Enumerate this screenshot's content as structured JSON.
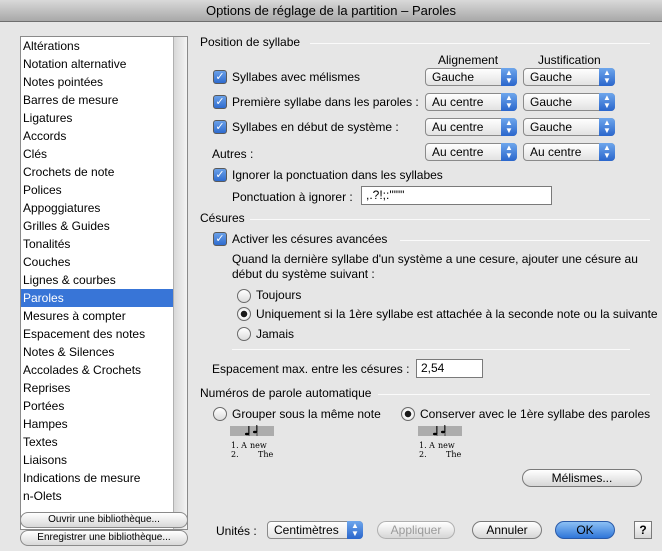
{
  "window": {
    "title": "Options de réglage de la partition – Paroles"
  },
  "sidebar": {
    "items": [
      {
        "label": "Altérations"
      },
      {
        "label": "Notation alternative"
      },
      {
        "label": "Notes pointées"
      },
      {
        "label": "Barres de mesure"
      },
      {
        "label": "Ligatures"
      },
      {
        "label": "Accords"
      },
      {
        "label": "Clés"
      },
      {
        "label": "Crochets de note"
      },
      {
        "label": "Polices"
      },
      {
        "label": "Appoggiatures"
      },
      {
        "label": "Grilles & Guides"
      },
      {
        "label": "Tonalités"
      },
      {
        "label": "Couches"
      },
      {
        "label": "Lignes & courbes"
      },
      {
        "label": "Paroles"
      },
      {
        "label": "Mesures à compter"
      },
      {
        "label": "Espacement des notes"
      },
      {
        "label": "Notes & Silences"
      },
      {
        "label": "Accolades & Crochets"
      },
      {
        "label": "Reprises"
      },
      {
        "label": "Portées"
      },
      {
        "label": "Hampes"
      },
      {
        "label": "Textes"
      },
      {
        "label": "Liaisons"
      },
      {
        "label": "Indications de mesure"
      },
      {
        "label": "n-Olets"
      }
    ],
    "selected": "Paroles",
    "open_library": "Ouvrir une bibliothèque...",
    "save_library": "Enregistrer une bibliothèque..."
  },
  "syllable_position": {
    "title": "Position de syllabe",
    "col_alignment": "Alignement",
    "col_justification": "Justification",
    "rows": [
      {
        "label": "Syllabes avec mélismes",
        "checked": true,
        "alignment": "Gauche",
        "justification": "Gauche"
      },
      {
        "label": "Première syllabe dans les paroles :",
        "checked": true,
        "alignment": "Au centre",
        "justification": "Gauche"
      },
      {
        "label": "Syllabes en début de système :",
        "checked": true,
        "alignment": "Au centre",
        "justification": "Gauche"
      }
    ],
    "others_label": "Autres :",
    "others_alignment": "Au centre",
    "others_justification": "Au centre",
    "ignore_punct_label": "Ignorer la ponctuation dans les syllabes",
    "ignore_punct_checked": true,
    "punct_label": "Ponctuation à ignorer :",
    "punct_value": ",.?!;:'\"\"\""
  },
  "hyphens": {
    "title": "Césures",
    "advanced_label": "Activer les césures avancées",
    "advanced_checked": true,
    "description_line1": "Quand la dernière syllabe d'un système a une cesure, ajouter une césure au",
    "description_line2": "début du système suivant :",
    "options": [
      {
        "label": "Toujours",
        "selected": false
      },
      {
        "label": "Uniquement si la 1ère syllabe est attachée à la seconde note ou la suivante",
        "selected": true
      },
      {
        "label": "Jamais",
        "selected": false
      }
    ],
    "max_spacing_label": "Espacement max. entre les césures :",
    "max_spacing_value": "2,54"
  },
  "auto_numbering": {
    "title": "Numéros de parole automatique",
    "option_group": "Grouper sous la même note",
    "option_keep": "Conserver avec le 1ère syllabe des paroles",
    "selected": "keep",
    "example_line1": "1. A",
    "example_word": "new",
    "example_line2": "2.",
    "example_word2": "The",
    "melismas_button": "Mélismes..."
  },
  "footer": {
    "units_label": "Unités :",
    "units_value": "Centimètres",
    "apply": "Appliquer",
    "cancel": "Annuler",
    "ok": "OK",
    "help": "?"
  },
  "colors": {
    "accent": "#3875d7",
    "window_bg": "#e6e6e6"
  }
}
